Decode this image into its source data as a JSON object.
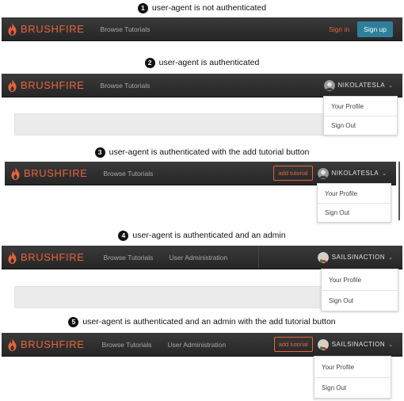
{
  "brand": {
    "name": "BRUSHFIRE",
    "logo_icon": "flame-icon",
    "color": "#e8643c"
  },
  "nav": {
    "browse": "Browse Tutorials",
    "admin": "User Administration",
    "signin": "Sign in",
    "signup": "Sign up",
    "add_tutorial": "add tutorial"
  },
  "users": {
    "nikola": "NIKOLATESLA",
    "sails": "SAILSINACTION"
  },
  "dropdown": {
    "profile": "Your Profile",
    "signout": "Sign Out"
  },
  "captions": [
    {
      "num": "1",
      "text": "user-agent is not authenticated"
    },
    {
      "num": "2",
      "text": "user-agent is authenticated"
    },
    {
      "num": "3",
      "text": "user-agent is authenticated with the add tutorial button"
    },
    {
      "num": "4",
      "text": "user-agent is authenticated and an admin"
    },
    {
      "num": "5",
      "text": "user-agent is authenticated and an admin with the add tutorial button"
    }
  ],
  "colors": {
    "navbar": "#2e2e2e",
    "accent": "#e8643c",
    "signup_bg": "#2f7f9a"
  }
}
